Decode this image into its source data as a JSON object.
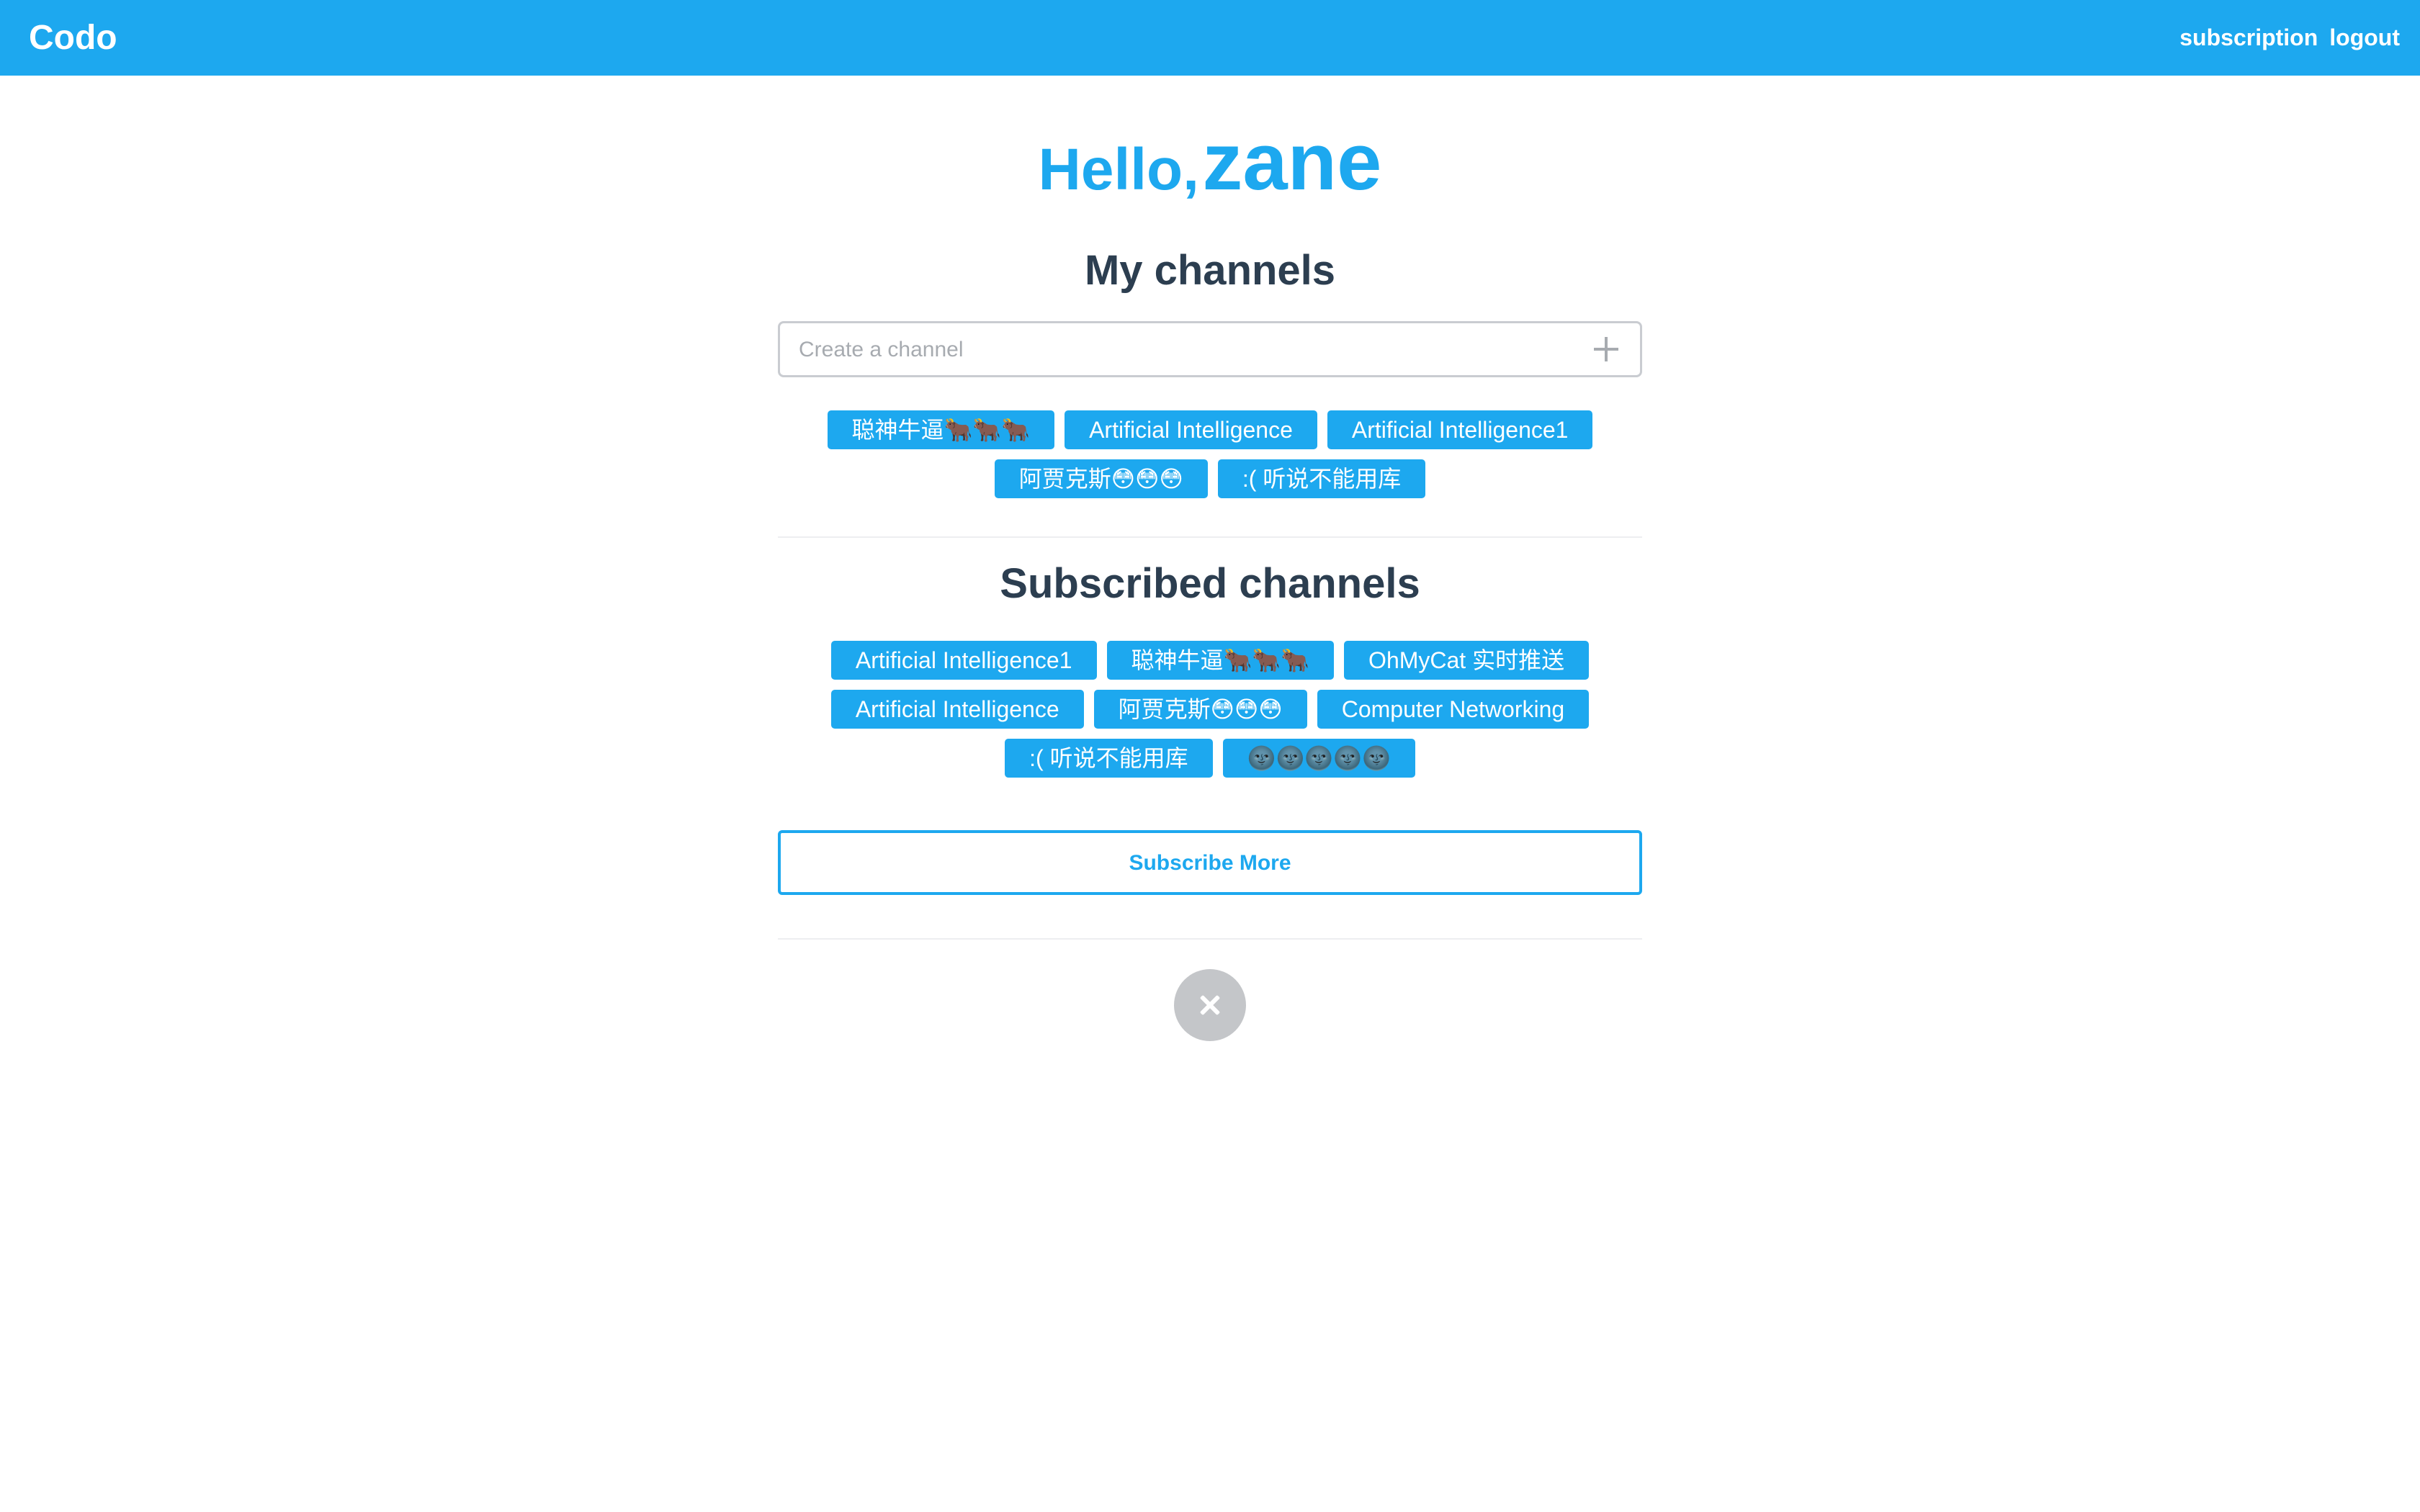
{
  "nav": {
    "brand": "Codo",
    "links": [
      "subscription",
      "logout"
    ]
  },
  "greeting": {
    "prefix": "Hello,",
    "username": "zane"
  },
  "my_channels": {
    "title": "My channels",
    "create_placeholder": "Create a channel",
    "channels": [
      "聪神牛逼🐂🐂🐂",
      "Artificial Intelligence",
      "Artificial Intelligence1",
      "阿贾克斯😳😳😳",
      ":( 听说不能用库"
    ]
  },
  "subscribed_channels": {
    "title": "Subscribed channels",
    "channels": [
      "Artificial Intelligence1",
      "聪神牛逼🐂🐂🐂",
      "OhMyCat 实时推送",
      "Artificial Intelligence",
      "阿贾克斯😳😳😳",
      "Computer Networking",
      ":( 听说不能用库",
      "🌚🌚🌚🌚🌚"
    ]
  },
  "subscribe_more_label": "Subscribe More",
  "colors": {
    "accent": "#1da8ef",
    "heading": "#2c3e50",
    "close_button": "#c4c6c9"
  }
}
